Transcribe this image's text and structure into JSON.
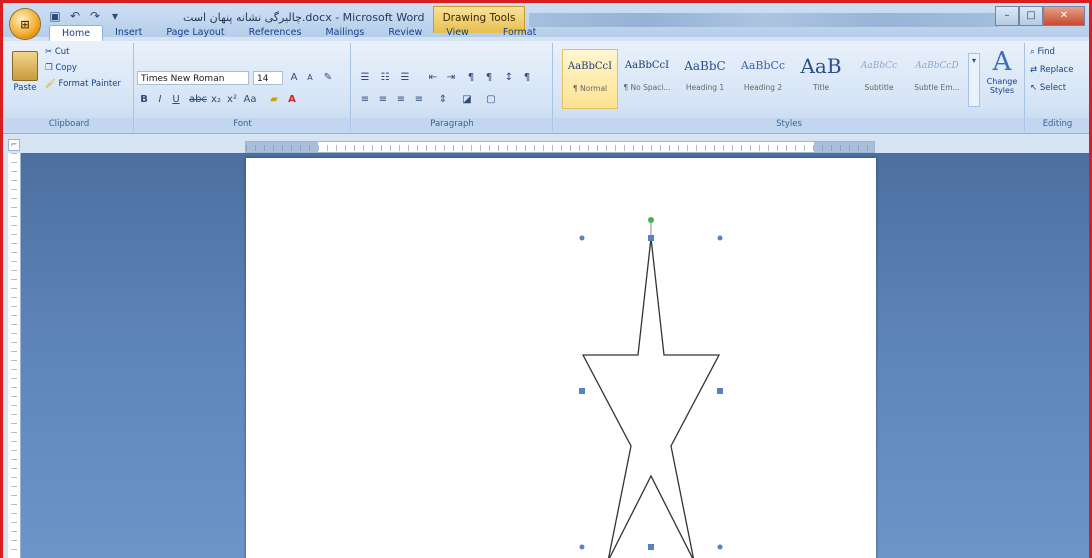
{
  "window": {
    "title": "چالیرگی نشانه پنهان است.docx - Microsoft Word",
    "context_tab": "Drawing Tools"
  },
  "ribbon_tabs": [
    "Home",
    "Insert",
    "Page Layout",
    "References",
    "Mailings",
    "Review",
    "View",
    "Format"
  ],
  "clipboard": {
    "paste": "Paste",
    "cut": "Cut",
    "copy": "Copy",
    "format_painter": "Format Painter",
    "label": "Clipboard"
  },
  "font": {
    "name": "Times New Roman",
    "size": "14",
    "label": "Font"
  },
  "paragraph": {
    "label": "Paragraph"
  },
  "styles": {
    "items": [
      {
        "preview": "AaBbCcI",
        "name": "¶ Normal"
      },
      {
        "preview": "AaBbCcI",
        "name": "¶ No Spaci..."
      },
      {
        "preview": "AaBbC",
        "name": "Heading 1"
      },
      {
        "preview": "AaBbCc",
        "name": "Heading 2"
      },
      {
        "preview": "AaB",
        "name": "Title"
      },
      {
        "preview": "AaBbCc",
        "name": "Subtitle"
      },
      {
        "preview": "AaBbCcD",
        "name": "Subtle Em..."
      }
    ],
    "change_styles": "Change Styles",
    "label": "Styles"
  },
  "editing": {
    "find": "Find",
    "replace": "Replace",
    "select": "Select",
    "label": "Editing"
  },
  "colors": {
    "accent_border": "#d81e1e",
    "star_stroke": "#333333",
    "handle": "#5b82c0",
    "rotate_handle": "#4caf50"
  },
  "icons": [
    "office-button-icon",
    "save-icon",
    "undo-icon",
    "redo-icon",
    "cut-icon",
    "copy-icon",
    "format-painter-icon",
    "bold-icon",
    "italic-icon",
    "underline-icon",
    "find-icon",
    "replace-icon",
    "select-icon"
  ]
}
